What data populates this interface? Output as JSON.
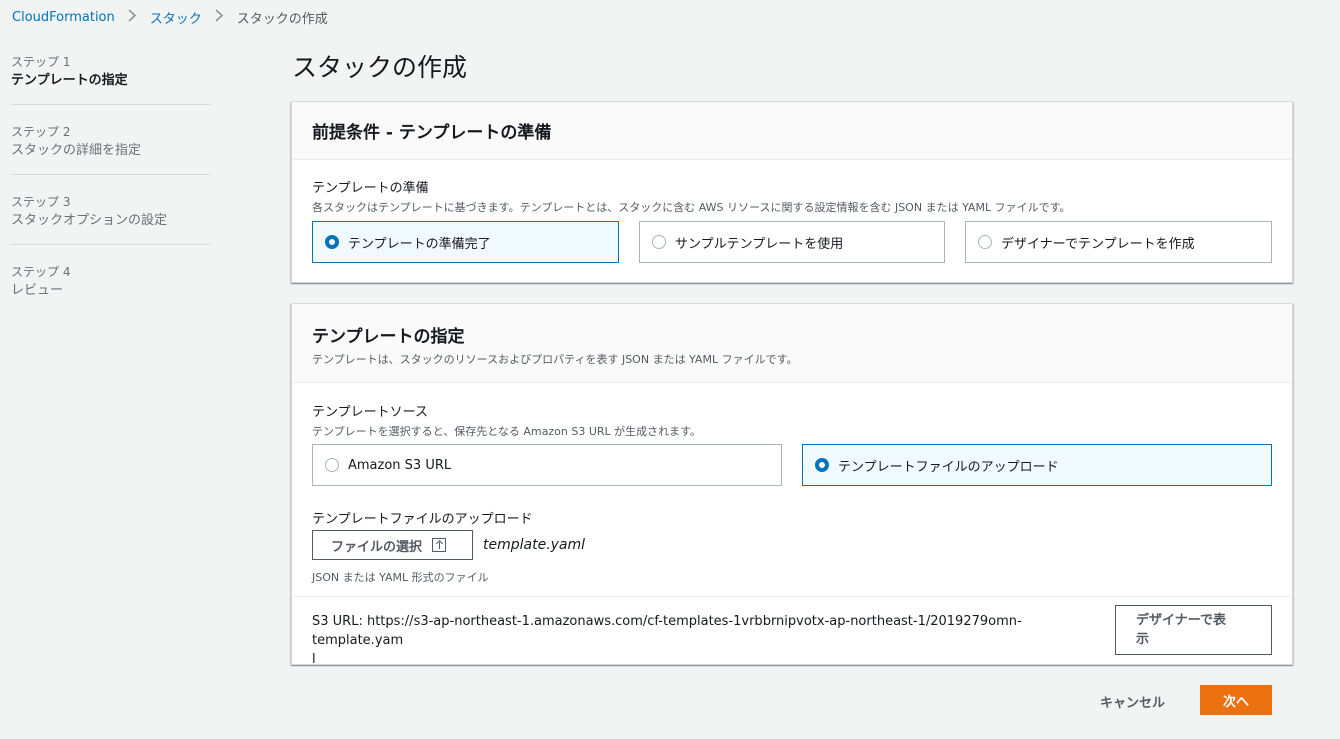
{
  "breadcrumb": {
    "root": "CloudFormation",
    "level2": "スタック",
    "current": "スタックの作成"
  },
  "steps": [
    {
      "num": "ステップ 1",
      "label": "テンプレートの指定",
      "active": true
    },
    {
      "num": "ステップ 2",
      "label": "スタックの詳細を指定",
      "active": false
    },
    {
      "num": "ステップ 3",
      "label": "スタックオプションの設定",
      "active": false
    },
    {
      "num": "ステップ 4",
      "label": "レビュー",
      "active": false
    }
  ],
  "page_title": "スタックの作成",
  "prereq": {
    "title": "前提条件 - テンプレートの準備",
    "field_label": "テンプレートの準備",
    "field_desc": "各スタックはテンプレートに基づきます。テンプレートとは、スタックに含む AWS リソースに関する設定情報を含む JSON または YAML ファイルです。",
    "options": [
      {
        "label": "テンプレートの準備完了",
        "selected": true
      },
      {
        "label": "サンプルテンプレートを使用",
        "selected": false
      },
      {
        "label": "デザイナーでテンプレートを作成",
        "selected": false
      }
    ]
  },
  "spec": {
    "title": "テンプレートの指定",
    "desc": "テンプレートは、スタックのリソースおよびプロパティを表す JSON または YAML ファイルです。",
    "source_label": "テンプレートソース",
    "source_desc": "テンプレートを選択すると、保存先となる Amazon S3 URL が生成されます。",
    "source_options": [
      {
        "label": "Amazon S3 URL",
        "selected": false
      },
      {
        "label": "テンプレートファイルのアップロード",
        "selected": true
      }
    ],
    "upload_label": "テンプレートファイルのアップロード",
    "choose_file_label": "ファイルの選択",
    "file_name": "template.yaml",
    "file_hint": "JSON または YAML 形式のファイル",
    "s3_url_prefix": "S3 URL:",
    "s3_url_line1": "https://s3-ap-northeast-1.amazonaws.com/cf-templates-1vrbbrnipvotx-ap-northeast-1/2019279omn-template.yam",
    "s3_url_line2": "l",
    "designer_line1": "デザイナーで表",
    "designer_line2": "示"
  },
  "footer": {
    "cancel_label": "キャンセル",
    "next_label": "次へ"
  },
  "colors": {
    "accent": "#0073bb",
    "primary_button": "#ec7211",
    "background": "#f2f3f3"
  }
}
